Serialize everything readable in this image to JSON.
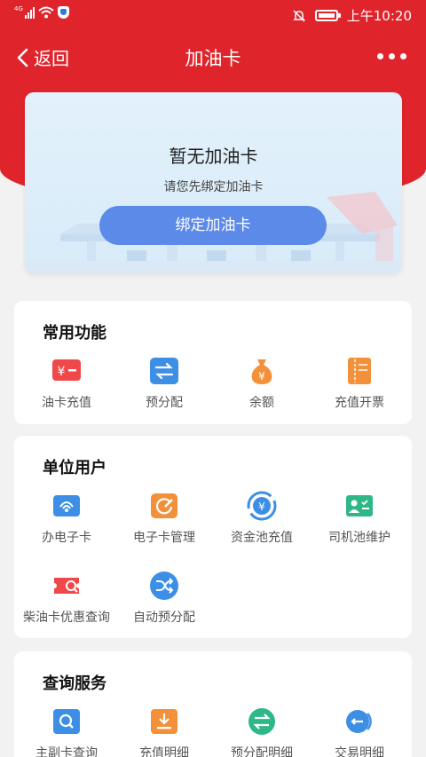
{
  "status_bar": {
    "network": "4G",
    "time": "上午10:20"
  },
  "nav": {
    "back_label": "返回",
    "title": "加油卡"
  },
  "hero": {
    "title": "暂无加油卡",
    "subtitle": "请您先绑定加油卡",
    "button_label": "绑定加油卡"
  },
  "sections": [
    {
      "title": "常用功能",
      "items": [
        {
          "label": "油卡充值",
          "icon": "fuel-card-recharge-icon",
          "color": "#f04848"
        },
        {
          "label": "预分配",
          "icon": "exchange-icon",
          "color": "#3d8fe6"
        },
        {
          "label": "余额",
          "icon": "money-bag-icon",
          "color": "#f3903a"
        },
        {
          "label": "充值开票",
          "icon": "invoice-icon",
          "color": "#f3903a"
        }
      ]
    },
    {
      "title": "单位用户",
      "items": [
        {
          "label": "办电子卡",
          "icon": "e-card-icon",
          "color": "#3d8fe6"
        },
        {
          "label": "电子卡管理",
          "icon": "card-manage-icon",
          "color": "#f3903a"
        },
        {
          "label": "资金池充值",
          "icon": "fund-pool-icon",
          "color": "#3d8fe6"
        },
        {
          "label": "司机池维护",
          "icon": "driver-pool-icon",
          "color": "#2fb887"
        },
        {
          "label": "柴油卡优惠查询",
          "icon": "diesel-discount-icon",
          "color": "#f04848"
        },
        {
          "label": "自动预分配",
          "icon": "shuffle-icon",
          "color": "#3d8fe6"
        }
      ]
    },
    {
      "title": "查询服务",
      "items": [
        {
          "label": "主副卡查询",
          "icon": "card-search-icon",
          "color": "#3d8fe6"
        },
        {
          "label": "充值明细",
          "icon": "recharge-detail-icon",
          "color": "#f3903a"
        },
        {
          "label": "预分配明细",
          "icon": "allocation-detail-icon",
          "color": "#2fb887"
        },
        {
          "label": "交易明细",
          "icon": "transaction-detail-icon",
          "color": "#3d8fe6"
        }
      ]
    }
  ]
}
